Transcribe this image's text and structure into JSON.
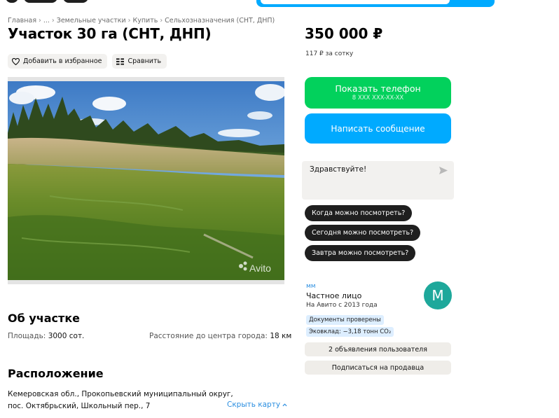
{
  "breadcrumbs": [
    "Главная",
    "...",
    "Земельные участки",
    "Купить",
    "Сельхозназначения (СНТ, ДНП)"
  ],
  "title": "Участок 30 га (СНТ, ДНП)",
  "actions": {
    "favorite_label": "Добавить в избранное",
    "compare_label": "Сравнить"
  },
  "photo": {
    "watermark": "Avito"
  },
  "about": {
    "heading": "Об участке",
    "area_label": "Площадь:",
    "area_value": "3000 сот.",
    "distance_label": "Расстояние до центра города:",
    "distance_value": "18 км"
  },
  "location": {
    "heading": "Расположение",
    "address_line1": "Кемеровская обл., Прокопьевский муниципальный округ,",
    "address_line2": "пос. Октябрьский, Школьный пер., 7",
    "hide_map_label": "Скрыть карту"
  },
  "price": {
    "value": "350 000 ₽",
    "per_sotka": "117 ₽ за сотку"
  },
  "contact": {
    "show_phone_label": "Показать телефон",
    "phone_masked": "8 XXX XXX-XX-XX",
    "write_message_label": "Написать сообщение",
    "message_text": "Здравствуйте!"
  },
  "quick_questions": [
    "Когда можно посмотреть?",
    "Сегодня можно посмотреть?",
    "Завтра можно посмотреть?"
  ],
  "seller": {
    "name": "мм",
    "type": "Частное лицо",
    "since": "На Авито с 2013 года",
    "avatar_letter": "M",
    "badge_docs": "Документы проверены",
    "badge_eco": "Эковклад: −3,18 тонн CO₂",
    "listings_label": "2 объявления пользователя",
    "subscribe_label": "Подписаться на продавца"
  },
  "colors": {
    "green": "#02d15c",
    "blue": "#00aaff",
    "link": "#2a8ee0",
    "avatar": "#1ea89b"
  }
}
